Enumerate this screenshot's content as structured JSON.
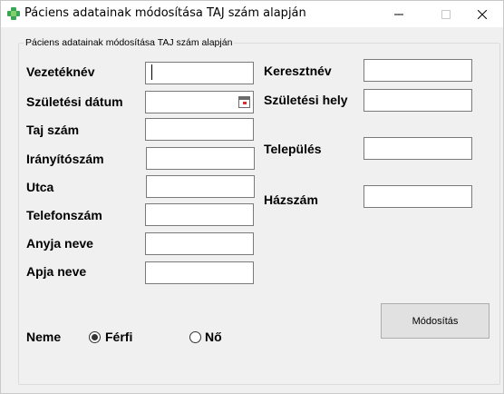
{
  "window": {
    "title": "Páciens adatainak módosítása TAJ szám alapján"
  },
  "group": {
    "title": "Páciens adatainak módosítása TAJ szám alapján"
  },
  "labels": {
    "vezeteknev": "Vezetéknév",
    "szuletesi_datum": "Születési dátum",
    "taj_szam": "Taj szám",
    "iranyitoszam": "Irányítószám",
    "utca": "Utca",
    "telefonszam": "Telefonszám",
    "anyja_neve": "Anyja neve",
    "apja_neve": "Apja neve",
    "keresztnev": "Keresztnév",
    "szuletesi_hely": "Születési hely",
    "telepules": "Település",
    "hazszam": "Házszám",
    "neme": "Neme"
  },
  "fields": {
    "vezeteknev": "",
    "szuletesi_datum": "",
    "taj_szam": "",
    "iranyitoszam": "",
    "utca": "",
    "telefonszam": "",
    "anyja_neve": "",
    "apja_neve": "",
    "keresztnev": "",
    "szuletesi_hely": "",
    "telepules": "",
    "hazszam": ""
  },
  "gender": {
    "options": [
      "Férfi",
      "Nő"
    ],
    "selected": "Férfi"
  },
  "buttons": {
    "modify": "Módosítás"
  },
  "colors": {
    "icon_green": "#3aa655",
    "window_bg": "#f0f0f0",
    "button_bg": "#e1e1e1"
  },
  "icons": {
    "app": "medical-cross-icon",
    "minimize": "minimize-icon",
    "maximize": "maximize-icon",
    "close": "close-icon",
    "calendar": "calendar-icon"
  }
}
